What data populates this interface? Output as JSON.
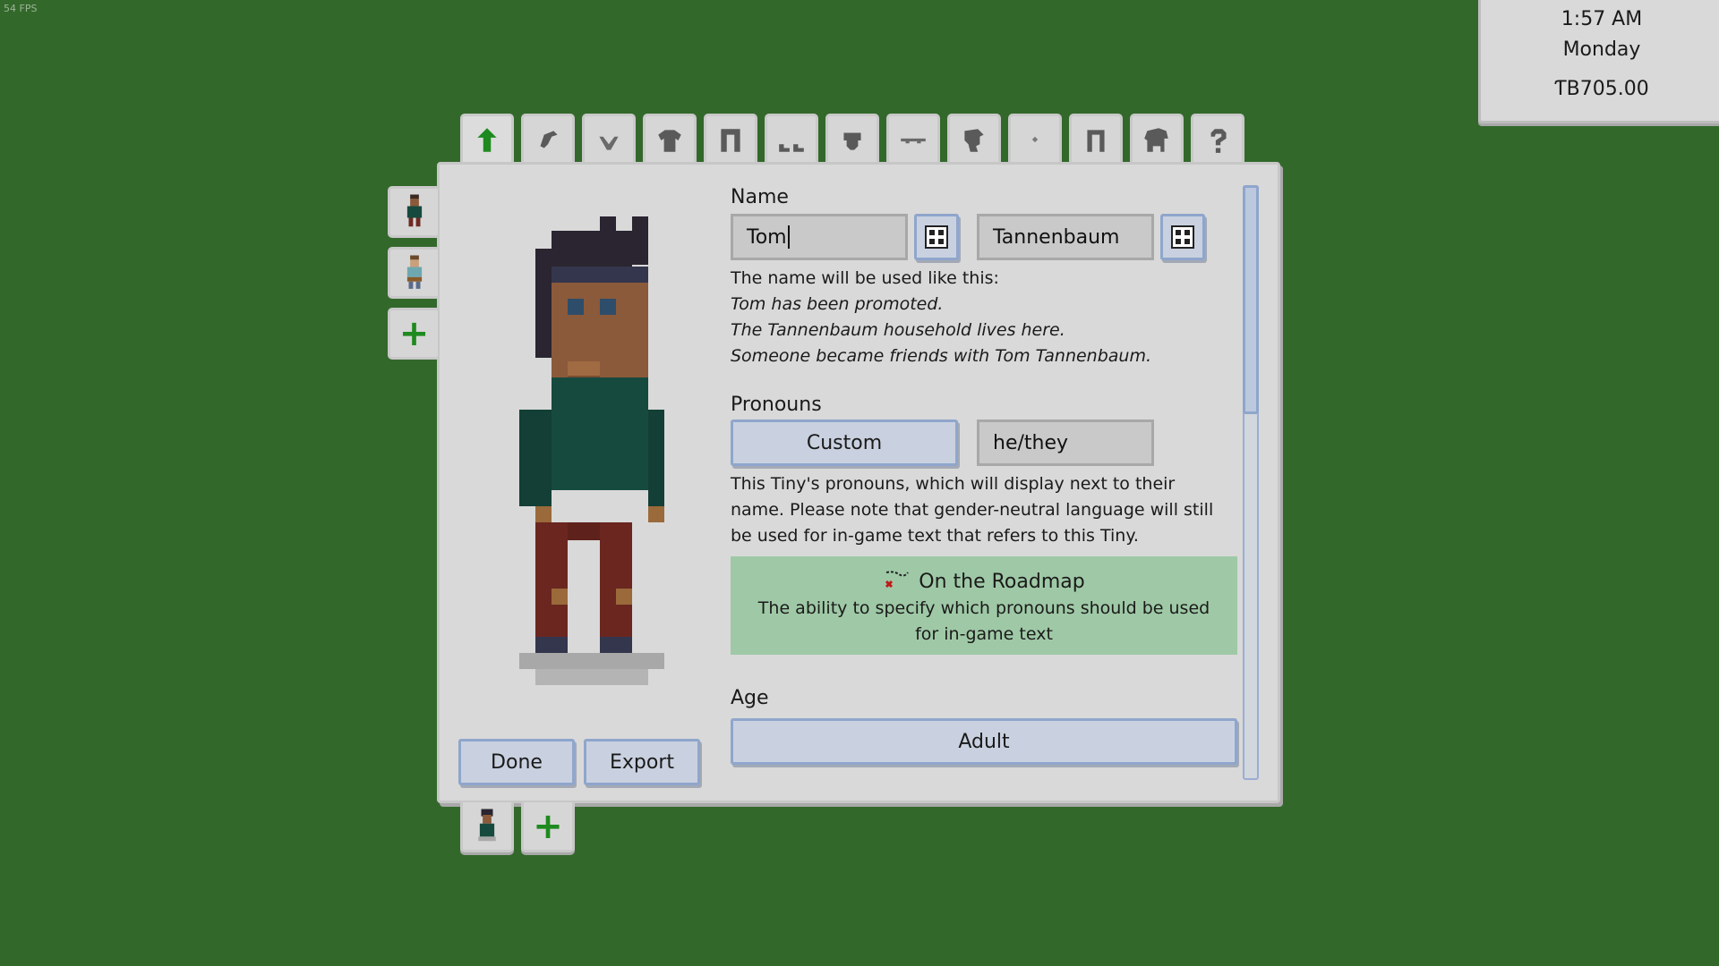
{
  "fps": "54 FPS",
  "hud": {
    "time": "1:57 AM",
    "day": "Monday",
    "money": "ƬB705.00"
  },
  "top_tabs": [
    "body-icon",
    "hair-icon",
    "beard-icon",
    "shirt-icon",
    "pants-icon",
    "shoes-icon",
    "hat-icon",
    "glasses-icon",
    "accessory-icon",
    "earring-icon",
    "legs-icon",
    "pet-icon",
    "help-icon"
  ],
  "name": {
    "label": "Name",
    "first": "Tom",
    "last": "Tannenbaum",
    "usage_intro": "The name will be used like this:",
    "example1": "Tom has been promoted.",
    "example2": "The Tannenbaum household lives here.",
    "example3": "Someone became friends with Tom Tannenbaum."
  },
  "pronouns": {
    "label": "Pronouns",
    "mode": "Custom",
    "value": "he/they",
    "desc_line1": "This Tiny's pronouns, which will display next to their",
    "desc_line2": "name. Please note that gender-neutral language will still",
    "desc_line3": "be used for in-game text that refers to this Tiny."
  },
  "roadmap": {
    "title": "On the Roadmap",
    "line1": "The ability to specify which pronouns should be used",
    "line2": "for in-game text"
  },
  "age": {
    "label": "Age",
    "value": "Adult"
  },
  "buttons": {
    "done": "Done",
    "export": "Export"
  },
  "colors": {
    "background": "#33682b",
    "panel": "#d9d9d9",
    "accent": "#8fa6cc",
    "roadmap": "#9fc9a6"
  }
}
